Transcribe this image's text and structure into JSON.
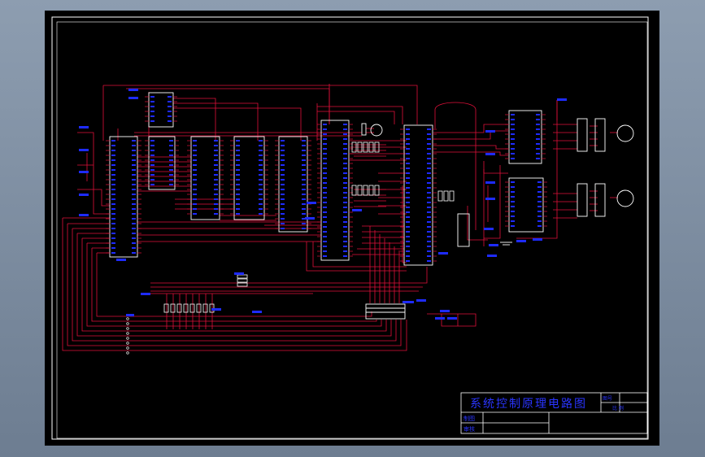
{
  "drawing": {
    "title_block": {
      "title": "系统控制原理电路图",
      "row_labels": [
        "制图",
        "审核"
      ],
      "right_labels": [
        "图号",
        "比 例"
      ]
    },
    "colors": {
      "sheet_bg": "#000000",
      "frame": "#ffffff",
      "wire": "#e0103a",
      "component": "#ffffff",
      "pin_label": "#1e2bff",
      "title_text": "#2a35ff"
    }
  }
}
